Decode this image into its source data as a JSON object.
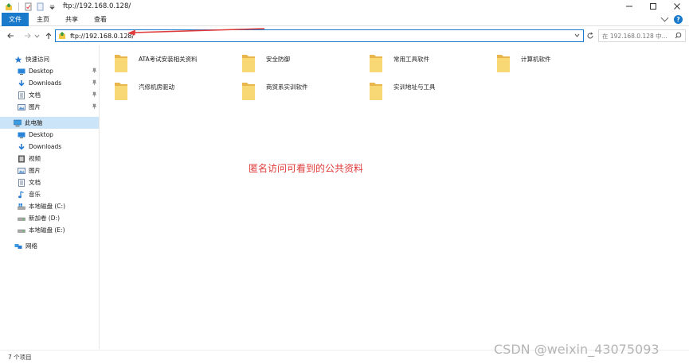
{
  "window": {
    "title": "ftp://192.168.0.128/"
  },
  "ribbon": {
    "tabs": [
      {
        "label": "文件"
      },
      {
        "label": "主页"
      },
      {
        "label": "共享"
      },
      {
        "label": "查看"
      }
    ]
  },
  "address": {
    "path": "ftp://192.168.0.128/",
    "search_placeholder": "在 192.168.0.128 中..."
  },
  "sidebar": {
    "quick_access": {
      "label": "快速访问",
      "items": [
        {
          "label": "Desktop",
          "icon": "desktop-icon"
        },
        {
          "label": "Downloads",
          "icon": "download-icon"
        },
        {
          "label": "文档",
          "icon": "document-icon"
        },
        {
          "label": "图片",
          "icon": "picture-icon"
        }
      ]
    },
    "this_pc": {
      "label": "此电脑",
      "items": [
        {
          "label": "Desktop",
          "icon": "desktop-icon"
        },
        {
          "label": "Downloads",
          "icon": "download-icon"
        },
        {
          "label": "视频",
          "icon": "video-icon"
        },
        {
          "label": "图片",
          "icon": "picture-icon"
        },
        {
          "label": "文档",
          "icon": "document-icon"
        },
        {
          "label": "音乐",
          "icon": "music-icon"
        },
        {
          "label": "本地磁盘 (C:)",
          "icon": "drive-icon"
        },
        {
          "label": "新加卷 (D:)",
          "icon": "drive-icon"
        },
        {
          "label": "本地磁盘 (E:)",
          "icon": "drive-icon"
        }
      ]
    },
    "network": {
      "label": "网络"
    }
  },
  "folders": [
    {
      "name": "ATA考试安装相关资料"
    },
    {
      "name": "安全防御"
    },
    {
      "name": "常用工具软件"
    },
    {
      "name": "计算机软件"
    },
    {
      "name": "汽修机房驱动"
    },
    {
      "name": "商贸系实训软件"
    },
    {
      "name": "实训地址与工具"
    }
  ],
  "annotation": {
    "text": "匿名访问可看到的公共资料",
    "color": "#e03a3a"
  },
  "status": {
    "item_count": "7 个项目"
  },
  "watermark": "CSDN @weixin_43075093",
  "colors": {
    "accent": "#1979ca",
    "selection": "#cce4f7",
    "folder": "#f8d775"
  }
}
